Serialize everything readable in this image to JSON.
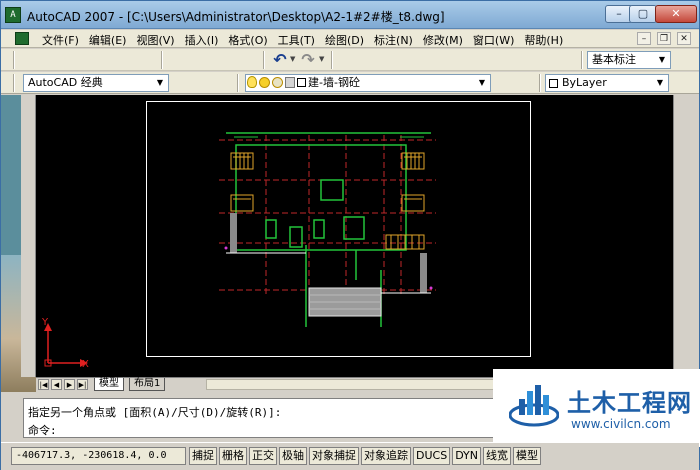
{
  "window": {
    "title": "AutoCAD 2007 - [C:\\Users\\Administrator\\Desktop\\A2-1#2#楼_t8.dwg]",
    "app_icon_text": "ACAD",
    "controls": {
      "minimize": "–",
      "maximize": "▢",
      "close": "✕"
    }
  },
  "menu": {
    "items": [
      "文件(F)",
      "编辑(E)",
      "视图(V)",
      "插入(I)",
      "格式(O)",
      "工具(T)",
      "绘图(D)",
      "标注(N)",
      "修改(M)",
      "窗口(W)",
      "帮助(H)"
    ],
    "doc_controls": {
      "minimize": "–",
      "restore": "❐",
      "close": "✕"
    }
  },
  "toolbar1": {
    "undo_icon": "undo-arrow-icon",
    "redo_icon": "redo-arrow-icon",
    "dim_style": "基本标注"
  },
  "toolbar2": {
    "workspace": "AutoCAD 经典",
    "layer": "建-墙-钢砼",
    "color": "ByLayer"
  },
  "ucs": {
    "x_label": "X",
    "y_label": "Y"
  },
  "tabs": {
    "model": "模型",
    "layout1": "布局1"
  },
  "command": {
    "line1": "指定另一个角点或 [面积(A)/尺寸(D)/旋转(R)]:",
    "line2": "命令:"
  },
  "status": {
    "coords": "-406717.3, -230618.4, 0.0",
    "buttons": [
      "捕捉",
      "栅格",
      "正交",
      "极轴",
      "对象捕捉",
      "对象追踪",
      "DUCS",
      "DYN",
      "线宽",
      "模型"
    ]
  },
  "watermark": {
    "title": "土木工程网",
    "url": "www.civilcn.com"
  },
  "colors": {
    "canvas": "#000000",
    "accent": "#1e5fa8"
  }
}
